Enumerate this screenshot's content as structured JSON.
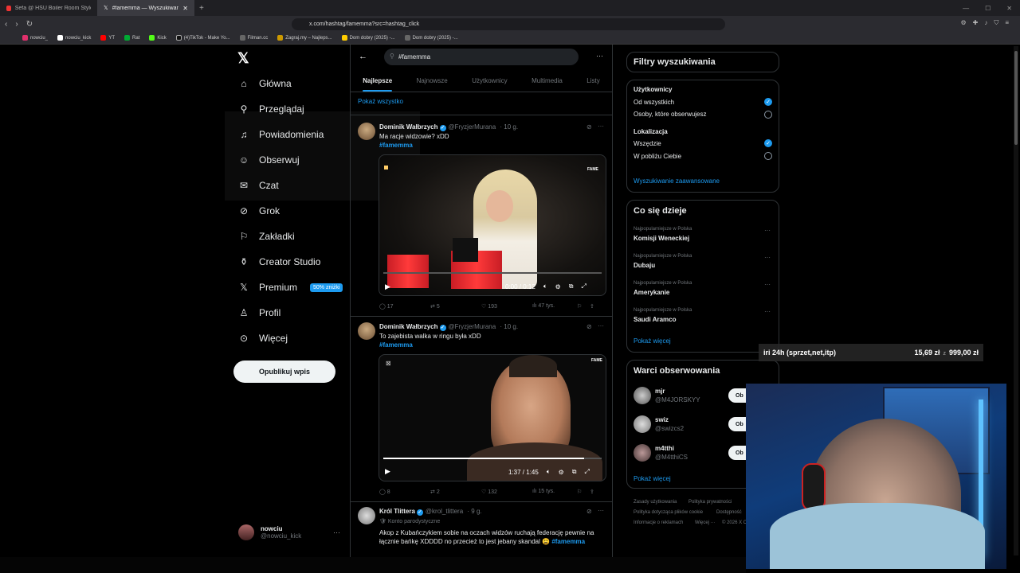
{
  "browser": {
    "tabs": [
      {
        "label": "Sefa @ HSU Boiler Room Style Party",
        "active": false
      },
      {
        "label": "#famemma — Wyszukiwanie / X",
        "active": true
      }
    ],
    "url": "x.com/hashtag/famemma?src=hashtag_click",
    "bookmarks": [
      "nowciu_",
      "nowciu_kick",
      "YT",
      "Rat",
      "Kick",
      "(4)TikTok - Make Yo...",
      "Filman.cc",
      "Zagraj.my – Najleps...",
      "Dom dobry (2025) -...",
      "Dom dobry (2025) -..."
    ]
  },
  "nav": {
    "items": [
      {
        "label": "Główna",
        "icon": "home-icon",
        "glyph": "⌂"
      },
      {
        "label": "Przeglądaj",
        "icon": "search-icon",
        "glyph": "⚲"
      },
      {
        "label": "Powiadomienia",
        "icon": "bell-icon",
        "glyph": "♫"
      },
      {
        "label": "Obserwuj",
        "icon": "add-person-icon",
        "glyph": "☺"
      },
      {
        "label": "Czat",
        "icon": "mail-icon",
        "glyph": "✉"
      },
      {
        "label": "Grok",
        "icon": "grok-icon",
        "glyph": "⊘"
      },
      {
        "label": "Zakładki",
        "icon": "bookmark-icon",
        "glyph": "⚐"
      },
      {
        "label": "Creator Studio",
        "icon": "creator-icon",
        "glyph": "⚱"
      },
      {
        "label": "Premium",
        "icon": "x-premium-icon",
        "glyph": "𝕏"
      },
      {
        "label": "Profil",
        "icon": "profile-icon",
        "glyph": "♙"
      },
      {
        "label": "Więcej",
        "icon": "more-circle-icon",
        "glyph": "⊙"
      }
    ],
    "premium_badge": "50% zniżki",
    "post_button": "Opublikuj wpis",
    "account": {
      "name": "nowciu",
      "handle": "@nowciu_kick"
    }
  },
  "search": {
    "query": "#famemma"
  },
  "tabs": [
    "Najlepsze",
    "Najnowsze",
    "Użytkownicy",
    "Multimedia",
    "Listy"
  ],
  "show_all": "Pokaż wszystko",
  "tweets": [
    {
      "name": "Dominik Wałbrzych",
      "handle": "@FryzjerMurana",
      "time": "· 10 g.",
      "text": "Ma racje widzowie? xDD",
      "hashtag": "#famemma",
      "video_time": "0:00 / 0:12",
      "progress": 0.0,
      "replies": "17",
      "reposts": "5",
      "likes": "193",
      "views": "47 tys."
    },
    {
      "name": "Dominik Wałbrzych",
      "handle": "@FryzjerMurana",
      "time": "· 10 g.",
      "text": "To zajebista walka w ringu była xDD",
      "hashtag": "#famemma",
      "video_time": "1:37 / 1:45",
      "progress": 0.92,
      "replies": "8",
      "reposts": "2",
      "likes": "132",
      "views": "15 tys."
    },
    {
      "name": "Król Tlittera",
      "handle": "@krol_tlittera",
      "time": "· 9 g.",
      "parody": "Konto parodystyczne",
      "text1": "Akop z Kubańczykiem sobie na oczach widzów ruchają federację pewnie na",
      "text2": "łącznie bańkę XDDDD no przecież to jest jebany skandal 😩",
      "hashtag": "#famemma"
    }
  ],
  "filters": {
    "title": "Filtry wyszukiwania",
    "users_label": "Użytkownicy",
    "users_options": [
      "Od wszystkich",
      "Osoby, które obserwujesz"
    ],
    "location_label": "Lokalizacja",
    "location_options": [
      "Wszędzie",
      "W pobliżu Ciebie"
    ],
    "advanced": "Wyszukiwanie zaawansowane"
  },
  "trends": {
    "title": "Co się dzieje",
    "items": [
      {
        "meta": "Najpopularniejsze w Polska",
        "name": "Komisji Weneckiej"
      },
      {
        "meta": "Najpopularniejsze w Polska",
        "name": "Dubaju"
      },
      {
        "meta": "Najpopularniejsze w Polska",
        "name": "Amerykanie"
      },
      {
        "meta": "Najpopularniejsze w Polska",
        "name": "Saudi Aramco"
      }
    ],
    "show_more": "Pokaż więcej"
  },
  "who_to_follow": {
    "title": "Warci obserwowania",
    "items": [
      {
        "name": "mjr",
        "handle": "@M4JORSKYY",
        "button": "Ob"
      },
      {
        "name": "swiz",
        "handle": "@swizcs2",
        "button": "Ob"
      },
      {
        "name": "m4tthi",
        "handle": "@M4tthiCS",
        "button": "Ob"
      }
    ],
    "show_more": "Pokaż więcej"
  },
  "footer": [
    "Zasady użytkowania",
    "Polityka prywatności",
    "Polityka dotycząca plików cookie",
    "Dostępność",
    "Informacje o reklamach",
    "Więcej ···",
    "© 2026 X C"
  ],
  "overlay": {
    "goal": "iri 24h (sprzet,net,itp)",
    "current": "15,69 zł",
    "of": "z",
    "target": "999,00 zł"
  },
  "colors": {
    "accent": "#1d9bf0",
    "background": "#000000",
    "text": "#e7e9ea",
    "muted": "#71767b"
  }
}
